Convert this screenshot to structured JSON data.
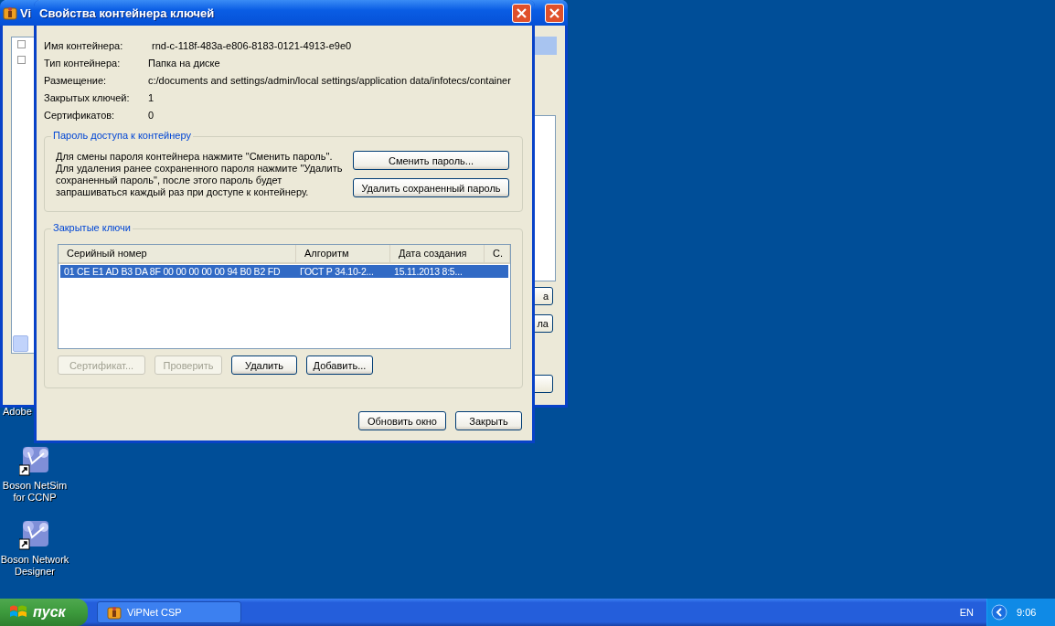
{
  "background_window": {
    "title": "Vi",
    "button_fragments": [
      "а",
      "ла"
    ]
  },
  "dialog": {
    "title": "Свойства контейнера ключей",
    "fields": [
      {
        "label": "Имя контейнера:",
        "value": "rnd-c-118f-483a-e806-8183-0121-4913-e9e0"
      },
      {
        "label": "Тип контейнера:",
        "value": "Папка на диске"
      },
      {
        "label": "Размещение:",
        "value": "c:/documents and settings/admin/local settings/application data/infotecs/container"
      },
      {
        "label": "Закрытых ключей:",
        "value": "1"
      },
      {
        "label": "Сертификатов:",
        "value": "0"
      }
    ],
    "password_group": {
      "title": "Пароль доступа к контейнеру",
      "text": "Для смены пароля контейнера нажмите \"Сменить пароль\". Для удаления ранее сохраненного пароля нажмите \"Удалить сохраненный пароль\", после этого пароль будет запрашиваться каждый раз при доступе к контейнеру.",
      "buttons": [
        {
          "label": "Сменить пароль...",
          "disabled": false
        },
        {
          "label": "Удалить сохраненный пароль",
          "disabled": false
        }
      ]
    },
    "keys_group": {
      "title": "Закрытые ключи",
      "columns": [
        "Серийный номер",
        "Алгоритм",
        "Дата создания",
        "С."
      ],
      "rows": [
        {
          "cells": [
            "01 CE E1 AD B3 DA 8F 00 00 00 00 00 94 B0 B2 FD",
            "ГОСТ Р 34.10-2...",
            "15.11.2013 8:5..."
          ],
          "selected": true
        }
      ],
      "buttons": [
        {
          "label": "Сертификат...",
          "disabled": true
        },
        {
          "label": "Проверить",
          "disabled": true
        },
        {
          "label": "Удалить",
          "disabled": false
        },
        {
          "label": "Добавить...",
          "disabled": false
        }
      ]
    },
    "buttons": [
      {
        "label": "Обновить окно",
        "disabled": false
      },
      {
        "label": "Закрыть",
        "disabled": false
      }
    ]
  },
  "desktop_icons": [
    {
      "label": "Adobe"
    },
    {
      "label": "Boson NetSim for CCNP"
    },
    {
      "label": "Boson Network Designer"
    }
  ],
  "taskbar": {
    "start": "пуск",
    "tasks": [
      {
        "label": "ViPNet CSP",
        "selected": false
      }
    ],
    "language": "EN",
    "clock": "9:06"
  }
}
